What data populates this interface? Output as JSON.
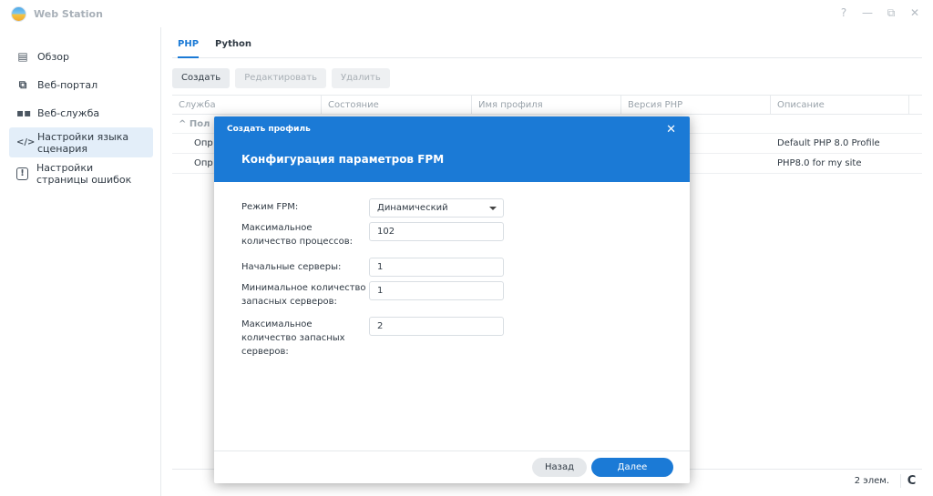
{
  "app": {
    "title": "Web Station"
  },
  "window_controls": {
    "help": "?",
    "minimize": "—",
    "restore": "⧉",
    "close": "✕"
  },
  "sidebar": {
    "items": [
      {
        "label": "Обзор",
        "icon": "overview-icon",
        "glyph": "▤"
      },
      {
        "label": "Веб-портал",
        "icon": "web-portal-icon",
        "glyph": "⧉"
      },
      {
        "label": "Веб-служба",
        "icon": "web-service-icon",
        "glyph": "▪▪"
      },
      {
        "label": "Настройки языка сценария",
        "icon": "script-language-icon",
        "glyph": "</>"
      },
      {
        "label": "Настройки страницы ошибок",
        "icon": "error-page-icon",
        "glyph": "!"
      }
    ]
  },
  "tabs": [
    {
      "label": "PHP"
    },
    {
      "label": "Python"
    }
  ],
  "toolbar": {
    "create": "Создать",
    "edit": "Редактировать",
    "delete": "Удалить"
  },
  "table": {
    "headers": [
      "Служба",
      "Состояние",
      "Имя профиля",
      "Версия PHP",
      "Описание"
    ],
    "group_label": "^ Пол",
    "rows": [
      {
        "service": "Опр",
        "description": "Default PHP 8.0 Profile"
      },
      {
        "service": "Опр",
        "description": "PHP8.0 for my site"
      }
    ],
    "count": "2 элем.",
    "refresh": "C"
  },
  "modal": {
    "subtitle": "Создать профиль",
    "close": "✕",
    "title": "Конфигурация параметров FPM",
    "fields": [
      {
        "label": "Режим FPM:",
        "value": "Динамический"
      },
      {
        "label": "Максимальное количество процессов:",
        "value": "102"
      },
      {
        "label": "Начальные серверы:",
        "value": "1"
      },
      {
        "label": "Минимальное количество запасных серверов:",
        "value": "1"
      },
      {
        "label": "Максимальное количество запасных серверов:",
        "value": "2"
      }
    ],
    "back": "Назад",
    "next": "Далее"
  },
  "colors": {
    "accent": "#1b7ad6",
    "sidebar_active": "#e3eef9"
  }
}
